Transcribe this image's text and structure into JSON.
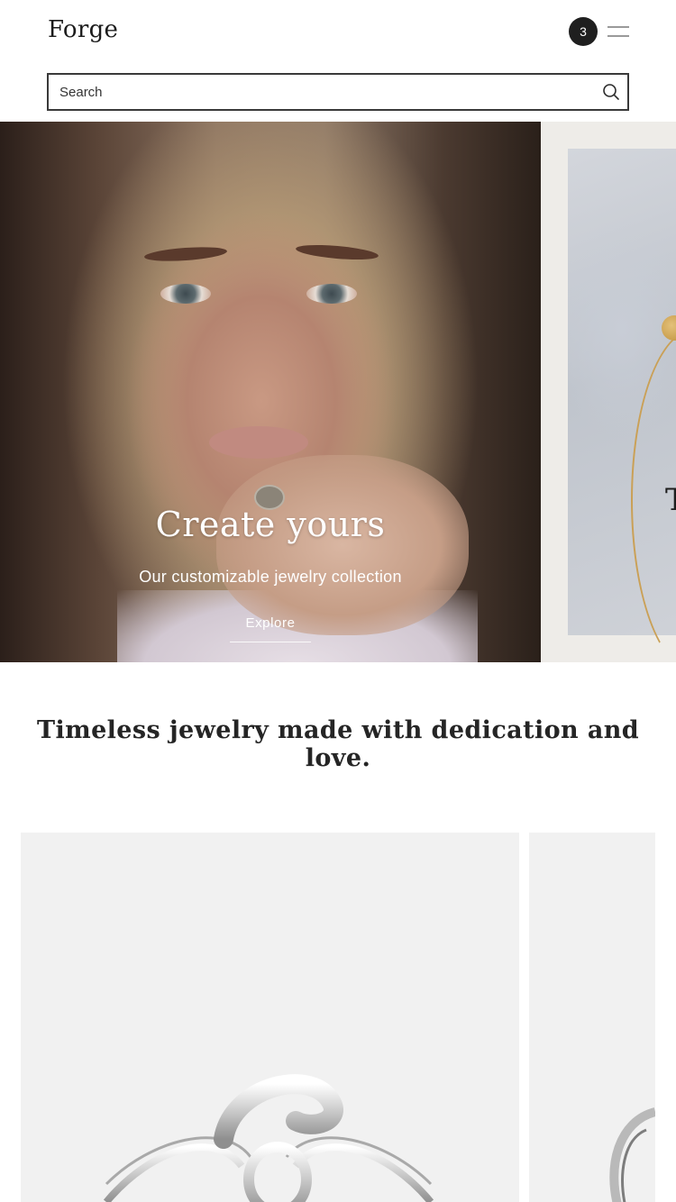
{
  "header": {
    "logo": "Forge",
    "cart_count": "3",
    "menu_icon": "hamburger-icon"
  },
  "search": {
    "placeholder": "Search",
    "icon": "search-icon"
  },
  "hero": {
    "slides": [
      {
        "title": "Create yours",
        "subtitle": "Our customizable jewelry collection",
        "cta": "Explore"
      },
      {
        "title_partial": "T"
      }
    ]
  },
  "tagline": "Timeless jewelry made with dedication and love.",
  "colors": {
    "text_dark": "#222222",
    "badge_bg": "#1f1f1f",
    "product_bg": "#f1f1f1",
    "accent_gold": "#caa056"
  }
}
